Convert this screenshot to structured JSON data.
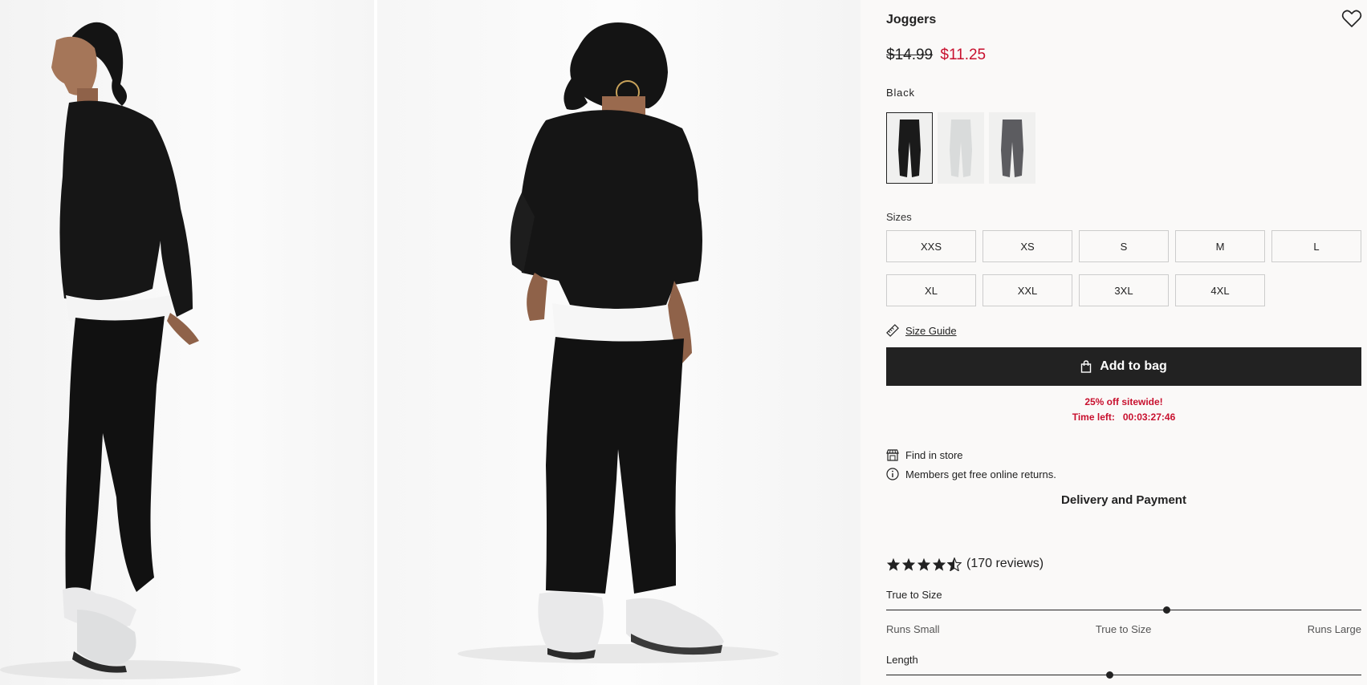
{
  "product": {
    "title": "Joggers",
    "price_original": "$14.99",
    "price_sale": "$11.25",
    "color_label": "Black",
    "colors": [
      {
        "name": "Black",
        "hex": "#1a1a1a",
        "selected": true
      },
      {
        "name": "Light grey",
        "hex": "#d9dbdb",
        "selected": false
      },
      {
        "name": "Dark grey",
        "hex": "#5c5c60",
        "selected": false
      }
    ]
  },
  "sizes": {
    "label": "Sizes",
    "options": [
      "XXS",
      "XS",
      "S",
      "M",
      "L",
      "XL",
      "XXL",
      "3XL",
      "4XL"
    ]
  },
  "size_guide_label": "Size Guide",
  "add_to_bag_label": "Add to bag",
  "promo": {
    "headline": "25% off sitewide!",
    "time_left_label": "Time left:",
    "time_left_value": "00:03:27:46"
  },
  "find_in_store_label": "Find in store",
  "free_returns_label": "Members get free online returns.",
  "delivery_label": "Delivery and Payment",
  "reviews": {
    "rating": 4.5,
    "count_label": "(170 reviews)"
  },
  "fit": [
    {
      "label": "True to Size",
      "value": 0.59,
      "scale": [
        "Runs Small",
        "True to Size",
        "Runs Large"
      ]
    },
    {
      "label": "Length",
      "value": 0.47
    }
  ],
  "icons": {
    "wishlist": "heart-icon",
    "size_guide": "ruler-icon",
    "bag": "shopping-bag-icon",
    "store": "store-icon",
    "info": "info-icon",
    "star": "star-icon"
  },
  "colors": {
    "sale_red": "#c8102e",
    "button_dark": "#222222",
    "panel_bg": "#faf9f8"
  }
}
